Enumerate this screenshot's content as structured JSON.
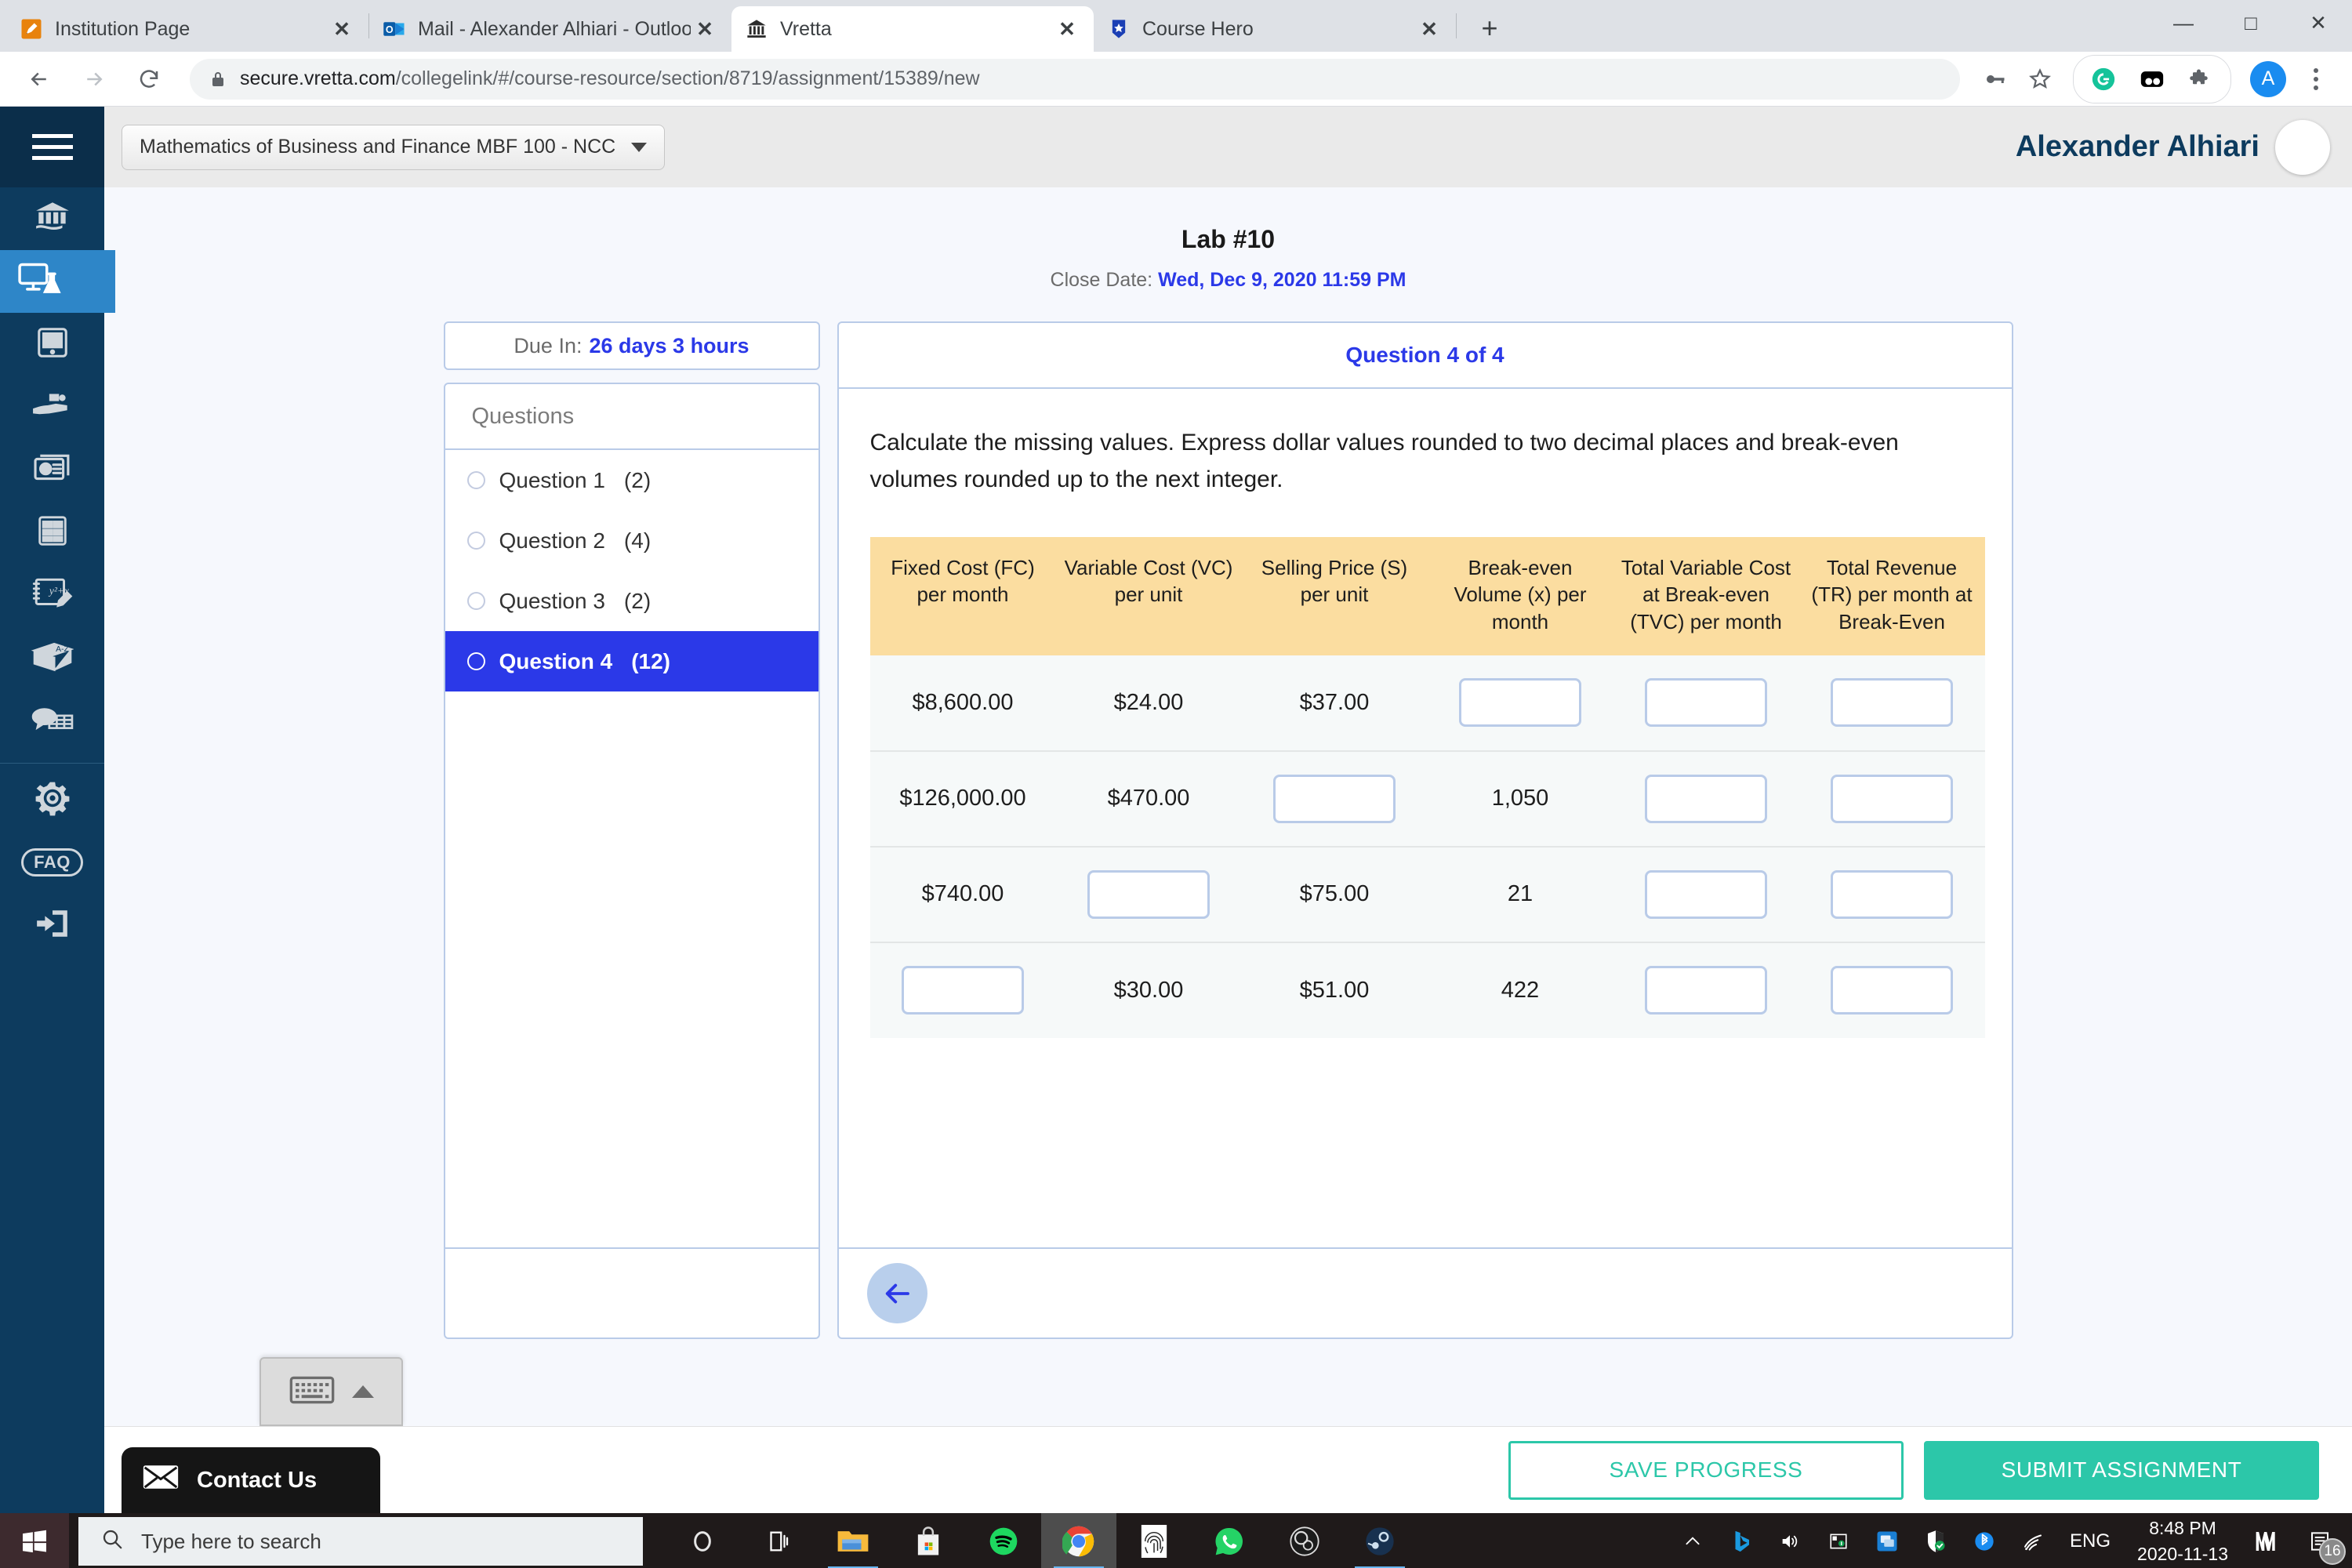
{
  "browser": {
    "tabs": [
      {
        "title": "Institution Page",
        "favicon": "pencil-icon",
        "active": false
      },
      {
        "title": "Mail - Alexander Alhiari - Outlook",
        "favicon": "outlook-icon",
        "active": false
      },
      {
        "title": "Vretta",
        "favicon": "bank-icon",
        "active": true
      },
      {
        "title": "Course Hero",
        "favicon": "coursehero-icon",
        "active": false
      }
    ],
    "new_tab_label": "+",
    "close_label": "✕",
    "window_controls": {
      "minimize": "—",
      "maximize": "□",
      "close": "✕"
    },
    "url_domain": "secure.vretta.com",
    "url_path": "/collegelink/#/course-resource/section/8719/assignment/15389/new",
    "profile_initial": "A"
  },
  "sidebar": {
    "items": [
      {
        "name": "institution-icon",
        "label": "Institution",
        "active": false
      },
      {
        "name": "lab-icon",
        "label": "Labs",
        "active": true
      },
      {
        "name": "tablet-icon",
        "label": "eText",
        "active": false
      },
      {
        "name": "puzzle-hand-icon",
        "label": "Interactives",
        "active": false
      },
      {
        "name": "presentation-icon",
        "label": "Presentations",
        "active": false
      },
      {
        "name": "calculator-icon",
        "label": "Calculator",
        "active": false
      },
      {
        "name": "formula-notepad-icon",
        "label": "Formulas",
        "active": false
      },
      {
        "name": "book-icon",
        "label": "Dictionary",
        "active": false
      },
      {
        "name": "discussion-icon",
        "label": "Discussions",
        "active": false
      }
    ],
    "footer_items": [
      {
        "name": "gear-icon",
        "label": "Settings"
      },
      {
        "name": "faq-icon",
        "label": "FAQ"
      },
      {
        "name": "logout-icon",
        "label": "Log out"
      }
    ]
  },
  "header": {
    "course": "Mathematics of Business and Finance MBF 100 - NCC",
    "user_name": "Alexander Alhiari"
  },
  "assignment": {
    "title": "Lab #10",
    "close_date_label": "Close Date:",
    "close_date_value": "Wed, Dec 9, 2020 11:59 PM",
    "due_label": "Due In:",
    "due_value": "26 days 3 hours",
    "questions_header": "Questions",
    "questions": [
      {
        "label": "Question 1",
        "points": "(2)",
        "selected": false
      },
      {
        "label": "Question 2",
        "points": "(4)",
        "selected": false
      },
      {
        "label": "Question 3",
        "points": "(2)",
        "selected": false
      },
      {
        "label": "Question 4",
        "points": "(12)",
        "selected": true
      }
    ]
  },
  "question": {
    "counter": "Question 4 of 4",
    "prompt": "Calculate the missing values. Express dollar values rounded to two decimal places and break-even volumes rounded up to the next integer.",
    "table": {
      "columns": [
        "Fixed Cost (FC) per month",
        "Variable Cost (VC) per unit",
        "Selling Price (S) per unit",
        "Break-even Volume (x) per month",
        "Total Variable Cost at Break-even (TVC) per month",
        "Total Revenue (TR) per month at Break-Even"
      ],
      "rows": [
        [
          "$8,600.00",
          "$24.00",
          "$37.00",
          "",
          "",
          ""
        ],
        [
          "$126,000.00",
          "$470.00",
          "",
          "1,050",
          "",
          ""
        ],
        [
          "$740.00",
          "",
          "$75.00",
          "21",
          "",
          ""
        ],
        [
          "",
          "$30.00",
          "$51.00",
          "422",
          "",
          ""
        ]
      ]
    },
    "back_icon": "arrow-left-icon"
  },
  "footer": {
    "save_label": "SAVE PROGRESS",
    "submit_label": "SUBMIT ASSIGNMENT",
    "contact_label": "Contact Us",
    "accent": "#2cc7a9"
  },
  "taskbar": {
    "search_placeholder": "Type here to search",
    "apps": [
      {
        "name": "cortana-icon"
      },
      {
        "name": "task-view-icon"
      },
      {
        "name": "file-explorer-icon"
      },
      {
        "name": "microsoft-store-icon"
      },
      {
        "name": "spotify-icon"
      },
      {
        "name": "chrome-icon"
      },
      {
        "name": "fingerprint-app-icon"
      },
      {
        "name": "whatsapp-icon"
      },
      {
        "name": "obs-icon"
      },
      {
        "name": "steam-icon"
      }
    ],
    "language": "ENG",
    "time": "8:48 PM",
    "date": "2020-11-13",
    "notification_count": "16"
  }
}
